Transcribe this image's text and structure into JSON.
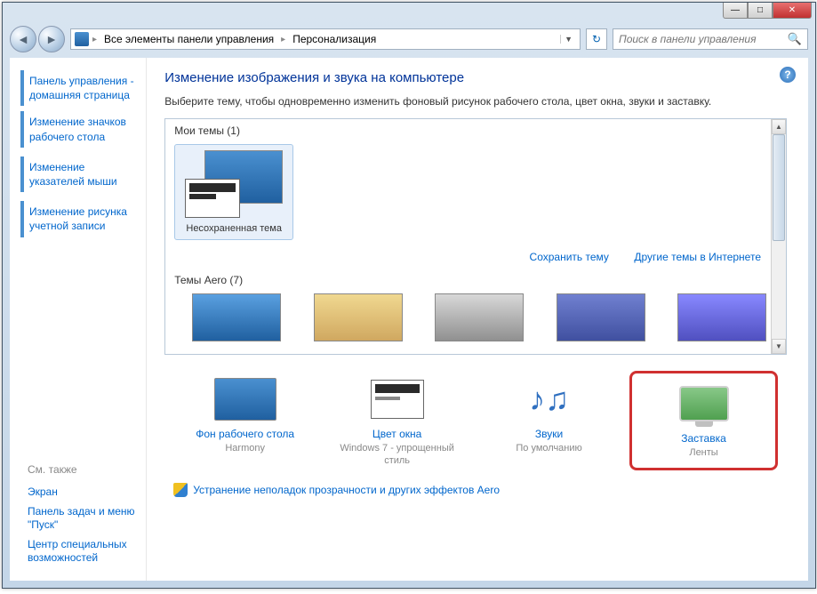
{
  "breadcrumb": {
    "item1": "Все элементы панели управления",
    "item2": "Персонализация"
  },
  "search": {
    "placeholder": "Поиск в панели управления"
  },
  "sidebar": {
    "home": "Панель управления - домашняя страница",
    "link1": "Изменение значков рабочего стола",
    "link2": "Изменение указателей мыши",
    "link3": "Изменение рисунка учетной записи",
    "see_also": "См. также",
    "foot1": "Экран",
    "foot2": "Панель задач и меню \"Пуск\"",
    "foot3": "Центр специальных возможностей"
  },
  "main": {
    "title": "Изменение изображения и звука на компьютере",
    "subtitle": "Выберите тему, чтобы одновременно изменить фоновый рисунок рабочего стола, цвет окна, звуки и заставку.",
    "my_themes_label": "Мои темы (1)",
    "unsaved_theme": "Несохраненная тема",
    "save_theme": "Сохранить тему",
    "other_themes": "Другие темы в Интернете",
    "aero_label": "Темы Aero (7)"
  },
  "settings": {
    "desktop_bg": {
      "title": "Фон рабочего стола",
      "value": "Harmony"
    },
    "window_color": {
      "title": "Цвет окна",
      "value": "Windows 7 - упрощенный стиль"
    },
    "sounds": {
      "title": "Звуки",
      "value": "По умолчанию"
    },
    "screensaver": {
      "title": "Заставка",
      "value": "Ленты"
    }
  },
  "troubleshoot": "Устранение неполадок прозрачности и других эффектов Aero"
}
